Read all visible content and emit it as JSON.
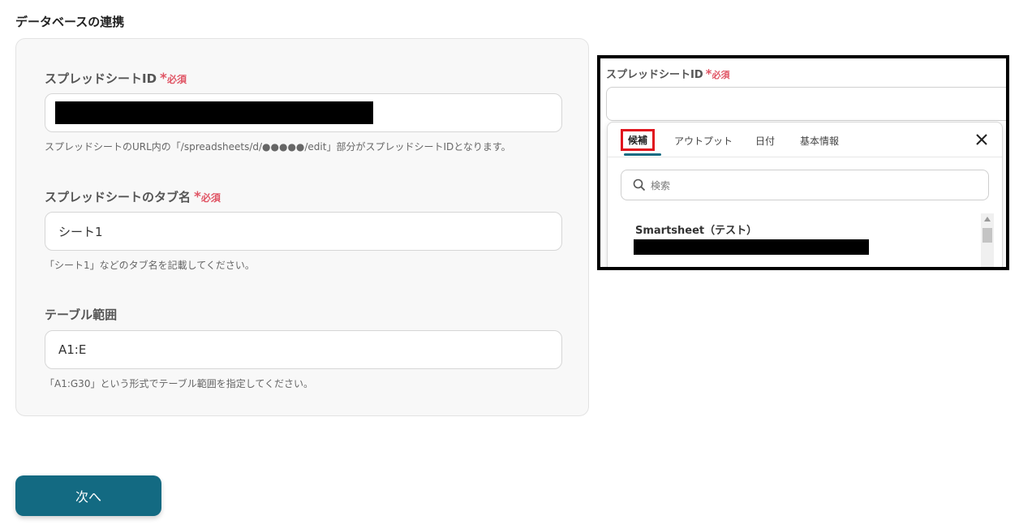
{
  "section_title": "データベースの連携",
  "fields": [
    {
      "label": "スプレッドシートID",
      "required_star": "*",
      "required_text": "必須",
      "value": "",
      "help": "スプレッドシートのURL内の「/spreadsheets/d/●●●●●/edit」部分がスプレッドシートIDとなります。"
    },
    {
      "label": "スプレッドシートのタブ名",
      "required_star": "*",
      "required_text": "必須",
      "value": "シート1",
      "help": "「シート1」などのタブ名を記載してください。"
    },
    {
      "label": "テーブル範囲",
      "value": "A1:E",
      "help": "「A1:G30」という形式でテーブル範囲を指定してください。"
    }
  ],
  "next_button": "次へ",
  "inset": {
    "label": "スプレッドシートID",
    "required_star": "*",
    "required_text": "必須",
    "tabs": [
      "候補",
      "アウトプット",
      "日付",
      "基本情報"
    ],
    "search_placeholder": "検索",
    "result_title": "Smartsheet（テスト）",
    "colors": {
      "accent": "#136a82",
      "highlight_box": "#e0141e",
      "required": "#e05565"
    }
  }
}
